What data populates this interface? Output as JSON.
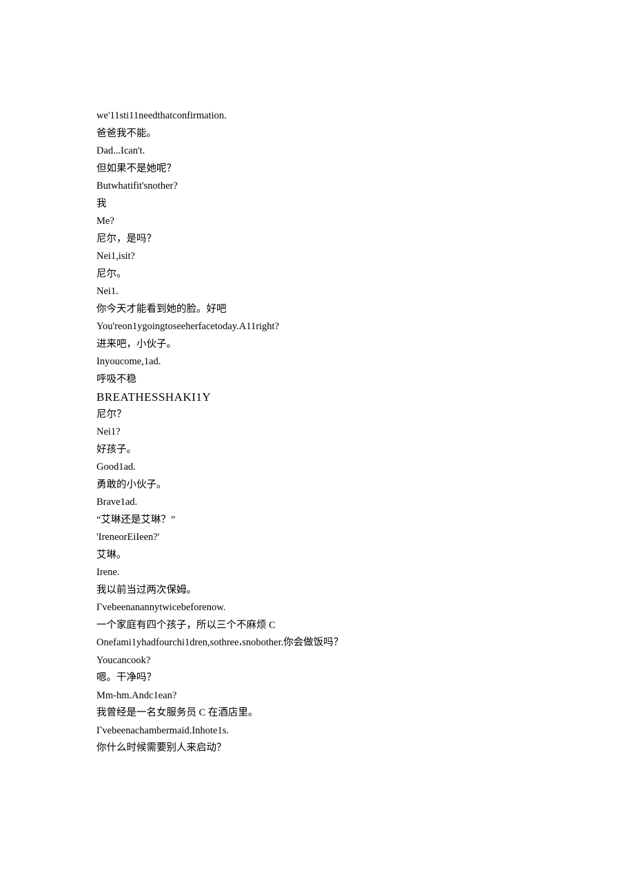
{
  "lines": [
    {
      "text": "we'11sti11needthatconfirmation.",
      "style": ""
    },
    {
      "text": "爸爸我不能。",
      "style": ""
    },
    {
      "text": "Dad...Ican't.",
      "style": ""
    },
    {
      "text": "但如果不是她呢？",
      "style": ""
    },
    {
      "text": "Butwhatifit'snother?",
      "style": ""
    },
    {
      "text": "我",
      "style": ""
    },
    {
      "text": "Me?",
      "style": ""
    },
    {
      "text": "尼尔，是吗？",
      "style": ""
    },
    {
      "text": "Nei1,isit?",
      "style": ""
    },
    {
      "text": "尼尔。",
      "style": ""
    },
    {
      "text": "Nei1.",
      "style": ""
    },
    {
      "text": "你今天才能看到她的脸。好吧",
      "style": ""
    },
    {
      "text": "You'reon1ygoingtoseeherfacetoday.A11right?",
      "style": ""
    },
    {
      "text": "进来吧，小伙子。",
      "style": ""
    },
    {
      "text": "Inyoucome,1ad.",
      "style": ""
    },
    {
      "text": "呼吸不稳",
      "style": ""
    },
    {
      "text": "BREATHESSHAKI1Y",
      "style": "small-caps"
    },
    {
      "text": "尼尔？",
      "style": ""
    },
    {
      "text": "Nei1?",
      "style": ""
    },
    {
      "text": "好孩子。",
      "style": ""
    },
    {
      "text": "Good1ad.",
      "style": ""
    },
    {
      "text": "勇敢的小伙子。",
      "style": ""
    },
    {
      "text": "Brave1ad.",
      "style": ""
    },
    {
      "text": "“艾琳还是艾琳？”",
      "style": ""
    },
    {
      "text": "'IreneorEiIeen?'",
      "style": ""
    },
    {
      "text": "艾琳。",
      "style": ""
    },
    {
      "text": "Irene.",
      "style": ""
    },
    {
      "text": "我以前当过两次保姆。",
      "style": ""
    },
    {
      "text": "Γvebeenanannytwicebeforenow.",
      "style": ""
    },
    {
      "text": "一个家庭有四个孩子，所以三个不麻烦 C",
      "style": ""
    },
    {
      "text": "Onefami1yhadfourchi1dren,sothree،snobother.你会做饭吗？",
      "style": ""
    },
    {
      "text": "Youcancook?",
      "style": ""
    },
    {
      "text": "嗯。干净吗？",
      "style": ""
    },
    {
      "text": "Mm-hm.Andc1ean?",
      "style": ""
    },
    {
      "text": "我曾经是一名女服务员 C 在酒店里。",
      "style": ""
    },
    {
      "text": "Γvebeenachambermaid.Inhote1s.",
      "style": ""
    },
    {
      "text": "你什么时候需要别人来启动？",
      "style": ""
    }
  ]
}
